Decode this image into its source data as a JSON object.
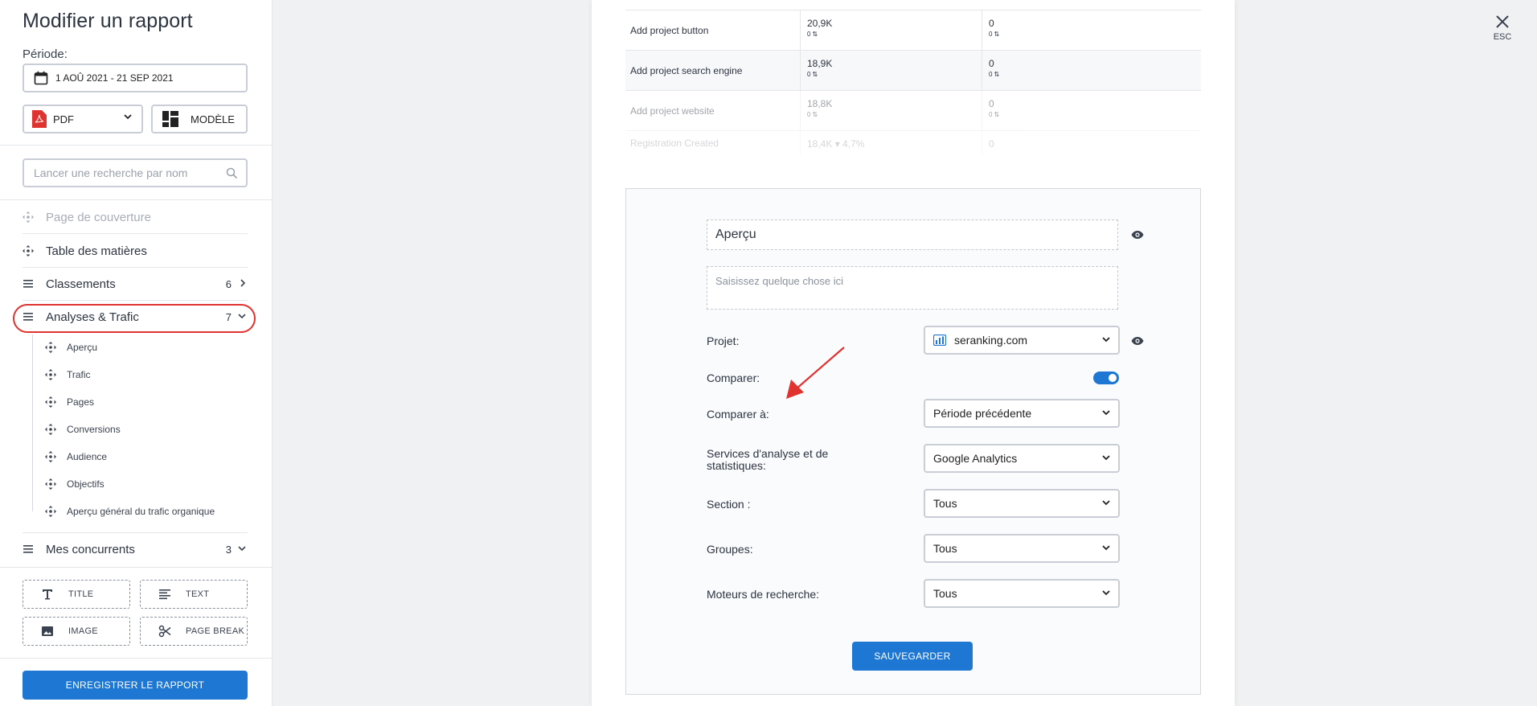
{
  "sidebar": {
    "title": "Modifier un rapport",
    "period_label": "Période:",
    "date_range": "1 AOÛ 2021 - 21 SEP 2021",
    "format": "PDF",
    "template_label": "MODÈLE",
    "search_placeholder": "Lancer une recherche par nom",
    "items": [
      {
        "label": "Page de couverture",
        "count": "",
        "icon": "move-icon",
        "disabled": true
      },
      {
        "label": "Table des matières",
        "count": "",
        "icon": "move-icon"
      },
      {
        "label": "Classements",
        "count": "6",
        "icon": "list-icon"
      },
      {
        "label": "Analyses & Trafic",
        "count": "7",
        "icon": "list-icon",
        "expanded": true
      },
      {
        "label": "Mes concurrents",
        "count": "3",
        "icon": "list-icon"
      }
    ],
    "subitems": [
      "Aperçu",
      "Trafic",
      "Pages",
      "Conversions",
      "Audience",
      "Objectifs",
      "Aperçu général du trafic organique"
    ],
    "elements": {
      "title": "TITLE",
      "text": "TEXT",
      "image": "IMAGE",
      "page_break": "PAGE BREAK"
    },
    "save_report": "ENREGISTRER LE RAPPORT"
  },
  "esc_label": "ESC",
  "table": {
    "rows": [
      {
        "name": "Add project button",
        "v1": "20,9K",
        "d1": "0",
        "v2": "0",
        "d2": "0"
      },
      {
        "name": "Add project search engine",
        "v1": "18,9K",
        "d1": "0",
        "v2": "0",
        "d2": "0"
      },
      {
        "name": "Add project website",
        "v1": "18,8K",
        "d1": "0",
        "v2": "0",
        "d2": "0"
      },
      {
        "name": "Registration Created",
        "v1": "18,4K",
        "d1": "▾ 4,7%",
        "v2": "0",
        "d2": ""
      }
    ]
  },
  "widget": {
    "title": "Aperçu",
    "text_placeholder": "Saisissez quelque chose ici",
    "project_label": "Projet:",
    "project_value": "seranking.com",
    "compare_label": "Comparer:",
    "compare_on": true,
    "compare_to_label": "Comparer à:",
    "compare_to_value": "Période précédente",
    "analytics_label": "Services d'analyse et de statistiques:",
    "analytics_value": "Google Analytics",
    "section_label": "Section :",
    "section_value": "Tous",
    "groups_label": "Groupes:",
    "groups_value": "Tous",
    "engines_label": "Moteurs de recherche:",
    "engines_value": "Tous",
    "save": "SAUVEGARDER"
  },
  "colors": {
    "accent": "#1f77d4",
    "highlight": "#e0322f",
    "pdf": "#e0322f"
  }
}
